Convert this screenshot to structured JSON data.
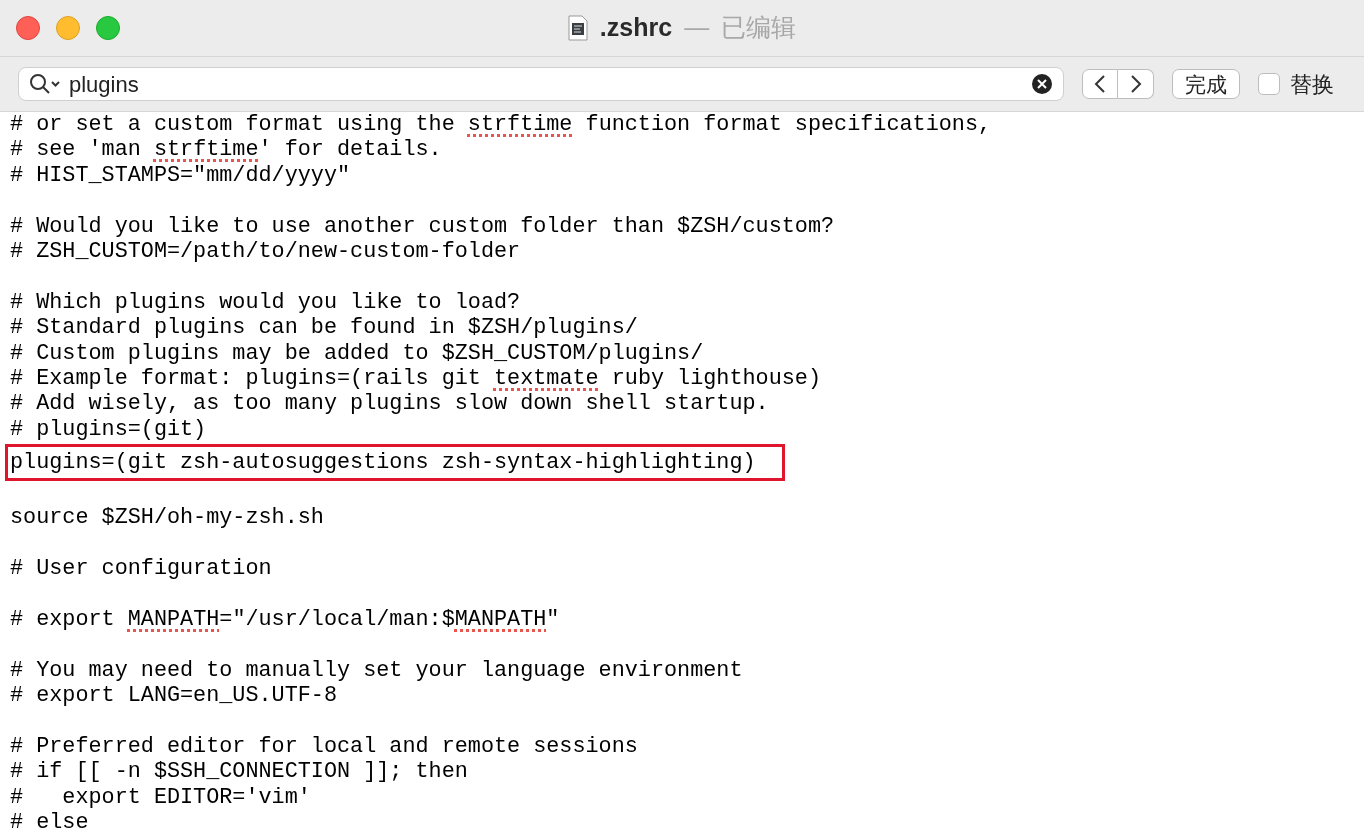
{
  "window": {
    "title": ".zshrc",
    "separator": "—",
    "status": "已编辑"
  },
  "find_bar": {
    "search": {
      "value": "plugins"
    },
    "done_button": "完成",
    "replace": {
      "label": "替换",
      "checked": false
    }
  },
  "editor": {
    "lines": [
      {
        "kind": "code",
        "segments": [
          {
            "text": "# or set a custom format using the ",
            "flagged": false
          },
          {
            "text": "strftime",
            "flagged": true
          },
          {
            "text": " function format specifications,",
            "flagged": false
          }
        ],
        "boxed": false
      },
      {
        "kind": "code",
        "segments": [
          {
            "text": "# see 'man ",
            "flagged": false
          },
          {
            "text": "strftime",
            "flagged": true
          },
          {
            "text": "' for details.",
            "flagged": false
          }
        ],
        "boxed": false
      },
      {
        "kind": "code",
        "segments": [
          {
            "text": "# HIST_STAMPS=\"mm/dd/yyyy\"",
            "flagged": false
          }
        ],
        "boxed": false
      },
      {
        "kind": "blank"
      },
      {
        "kind": "code",
        "segments": [
          {
            "text": "# Would you like to use another custom folder than $ZSH/custom?",
            "flagged": false
          }
        ],
        "boxed": false
      },
      {
        "kind": "code",
        "segments": [
          {
            "text": "# ZSH_CUSTOM=/path/to/new-custom-folder",
            "flagged": false
          }
        ],
        "boxed": false
      },
      {
        "kind": "blank"
      },
      {
        "kind": "code",
        "segments": [
          {
            "text": "# Which plugins would you like to load?",
            "flagged": false
          }
        ],
        "boxed": false
      },
      {
        "kind": "code",
        "segments": [
          {
            "text": "# Standard plugins can be found in $ZSH/plugins/",
            "flagged": false
          }
        ],
        "boxed": false
      },
      {
        "kind": "code",
        "segments": [
          {
            "text": "# Custom plugins may be added to $ZSH_CUSTOM/plugins/",
            "flagged": false
          }
        ],
        "boxed": false
      },
      {
        "kind": "code",
        "segments": [
          {
            "text": "# Example format: plugins=(rails git ",
            "flagged": false
          },
          {
            "text": "textmate",
            "flagged": true
          },
          {
            "text": " ruby lighthouse)",
            "flagged": false
          }
        ],
        "boxed": false
      },
      {
        "kind": "code",
        "segments": [
          {
            "text": "# Add wisely, as too many plugins slow down shell startup.",
            "flagged": false
          }
        ],
        "boxed": false
      },
      {
        "kind": "code",
        "segments": [
          {
            "text": "# plugins=(git)",
            "flagged": false
          }
        ],
        "boxed": false
      },
      {
        "kind": "code",
        "segments": [
          {
            "text": "plugins=(git zsh-autosuggestions zsh-syntax-highlighting)",
            "flagged": false
          }
        ],
        "boxed": true
      },
      {
        "kind": "blank"
      },
      {
        "kind": "code",
        "segments": [
          {
            "text": "source $ZSH/oh-my-zsh.sh",
            "flagged": false
          }
        ],
        "boxed": false
      },
      {
        "kind": "blank"
      },
      {
        "kind": "code",
        "segments": [
          {
            "text": "# User configuration",
            "flagged": false
          }
        ],
        "boxed": false
      },
      {
        "kind": "blank"
      },
      {
        "kind": "code",
        "segments": [
          {
            "text": "# export ",
            "flagged": false
          },
          {
            "text": "MANPATH",
            "flagged": true
          },
          {
            "text": "=\"/usr/local/man:$",
            "flagged": false
          },
          {
            "text": "MANPATH",
            "flagged": true
          },
          {
            "text": "\"",
            "flagged": false
          }
        ],
        "boxed": false
      },
      {
        "kind": "blank"
      },
      {
        "kind": "code",
        "segments": [
          {
            "text": "# You may need to manually set your language environment",
            "flagged": false
          }
        ],
        "boxed": false
      },
      {
        "kind": "code",
        "segments": [
          {
            "text": "# export LANG=en_US.UTF-8",
            "flagged": false
          }
        ],
        "boxed": false
      },
      {
        "kind": "blank"
      },
      {
        "kind": "code",
        "segments": [
          {
            "text": "# Preferred editor for local and remote sessions",
            "flagged": false
          }
        ],
        "boxed": false
      },
      {
        "kind": "code",
        "segments": [
          {
            "text": "# if [[ -n $SSH_CONNECTION ]]; then",
            "flagged": false
          }
        ],
        "boxed": false
      },
      {
        "kind": "code",
        "segments": [
          {
            "text": "#   export EDITOR='vim'",
            "flagged": false
          }
        ],
        "boxed": false
      },
      {
        "kind": "code",
        "segments": [
          {
            "text": "# else",
            "flagged": false
          }
        ],
        "boxed": false
      }
    ]
  }
}
